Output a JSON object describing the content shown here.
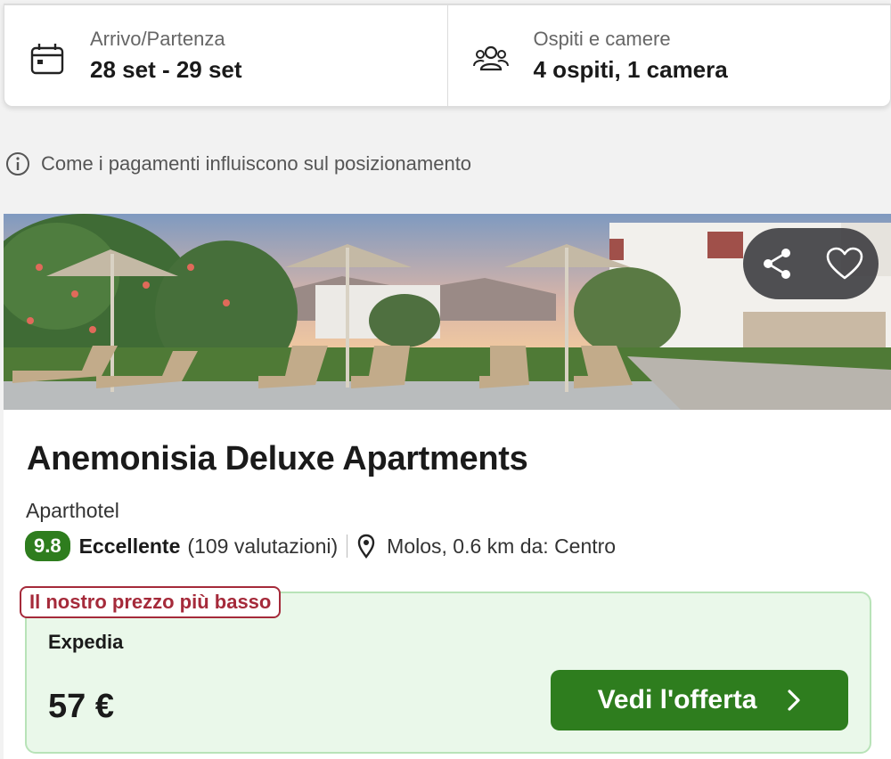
{
  "search": {
    "dates_label": "Arrivo/Partenza",
    "dates_value": "28 set - 29 set",
    "guests_label": "Ospiti e camere",
    "guests_value": "4 ospiti, 1 camera"
  },
  "payment_info": "Come i pagamenti influiscono sul posizionamento",
  "hotel": {
    "name": "Anemonisia Deluxe Apartments",
    "type": "Aparthotel",
    "score": "9.8",
    "rating_word": "Eccellente",
    "reviews": "(109 valutazioni)",
    "location": "Molos, 0.6 km da: Centro",
    "photo_icons": [
      "share-icon",
      "heart-icon"
    ]
  },
  "deal": {
    "badge": "Il nostro prezzo più basso",
    "provider": "Expedia",
    "price": "57 €",
    "button_label": "Vedi l'offerta"
  },
  "colors": {
    "brand_green": "#2e7d1e",
    "deal_bg": "#eaf8ea",
    "badge_red": "#a52a3a"
  }
}
